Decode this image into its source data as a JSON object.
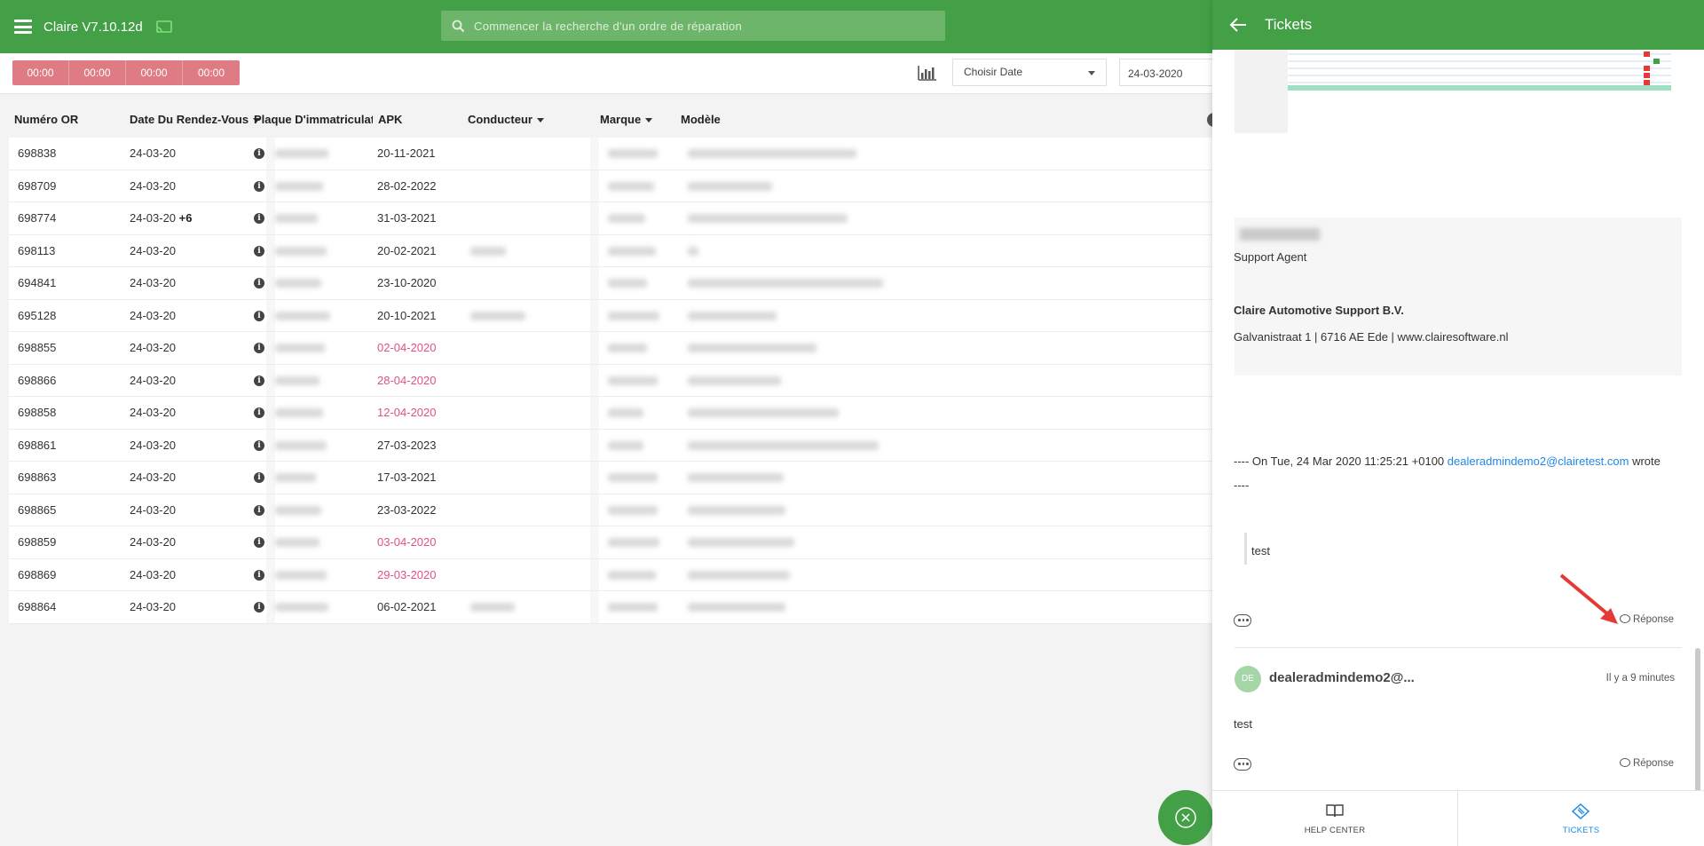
{
  "header": {
    "app_title": "Claire V7.10.12d",
    "search_placeholder": "Commencer la recherche d'un ordre de réparation"
  },
  "toolbar": {
    "timers": [
      "00:00",
      "00:00",
      "00:00",
      "00:00"
    ],
    "date_select": "Choisir Date",
    "date_value": "24-03-2020"
  },
  "table": {
    "headers": {
      "num": "Numéro OR",
      "date": "Date Du Rendez-Vous",
      "plate": "Plaque D'immatriculation",
      "apk": "APK",
      "driver": "Conducteur",
      "brand": "Marque",
      "model": "Modèle"
    },
    "rows": [
      {
        "num": "698838",
        "date": "24-03-20",
        "plus": "",
        "apk": "20-11-2021",
        "apk_overdue": false
      },
      {
        "num": "698709",
        "date": "24-03-20",
        "plus": "",
        "apk": "28-02-2022",
        "apk_overdue": false
      },
      {
        "num": "698774",
        "date": "24-03-20",
        "plus": "+6",
        "apk": "31-03-2021",
        "apk_overdue": false
      },
      {
        "num": "698113",
        "date": "24-03-20",
        "plus": "",
        "apk": "20-02-2021",
        "apk_overdue": false
      },
      {
        "num": "694841",
        "date": "24-03-20",
        "plus": "",
        "apk": "23-10-2020",
        "apk_overdue": false
      },
      {
        "num": "695128",
        "date": "24-03-20",
        "plus": "",
        "apk": "20-10-2021",
        "apk_overdue": false
      },
      {
        "num": "698855",
        "date": "24-03-20",
        "plus": "",
        "apk": "02-04-2020",
        "apk_overdue": true
      },
      {
        "num": "698866",
        "date": "24-03-20",
        "plus": "",
        "apk": "28-04-2020",
        "apk_overdue": true
      },
      {
        "num": "698858",
        "date": "24-03-20",
        "plus": "",
        "apk": "12-04-2020",
        "apk_overdue": true
      },
      {
        "num": "698861",
        "date": "24-03-20",
        "plus": "",
        "apk": "27-03-2023",
        "apk_overdue": false
      },
      {
        "num": "698863",
        "date": "24-03-20",
        "plus": "",
        "apk": "17-03-2021",
        "apk_overdue": false
      },
      {
        "num": "698865",
        "date": "24-03-20",
        "plus": "",
        "apk": "23-03-2022",
        "apk_overdue": false
      },
      {
        "num": "698859",
        "date": "24-03-20",
        "plus": "",
        "apk": "03-04-2020",
        "apk_overdue": true
      },
      {
        "num": "698869",
        "date": "24-03-20",
        "plus": "",
        "apk": "29-03-2020",
        "apk_overdue": true
      },
      {
        "num": "698864",
        "date": "24-03-20",
        "plus": "",
        "apk": "06-02-2021",
        "apk_overdue": false
      }
    ]
  },
  "panel": {
    "title": "Tickets",
    "signature": {
      "role": "Support Agent",
      "company": "Claire Automotive Support B.V.",
      "address": "Galvanistraat 1 | 6716 AE Ede | www.clairesoftware.nl"
    },
    "quote_header_prefix": "---- On  Tue, 24 Mar 2020 11:25:21 +0100",
    "quote_email": "dealeradmindemo2@clairetest.com",
    "quote_header_suffix": "wrote",
    "quote_dashes": "----",
    "quoted_text": "test",
    "reply_label": "Réponse",
    "comment": {
      "initials": "DE",
      "author": "dealeradmindemo2@...",
      "time": "Il y a 9 minutes",
      "body": "test",
      "reply_label": "Réponse"
    },
    "footer": {
      "help_label": "HELP CENTER",
      "tickets_label": "TICKETS"
    }
  },
  "colors": {
    "brand_green": "#43a047",
    "timer_red": "#df7b83",
    "apk_overdue": "#e0508b",
    "link_blue": "#1e88e5",
    "annotation_arrow": "#e53935"
  }
}
